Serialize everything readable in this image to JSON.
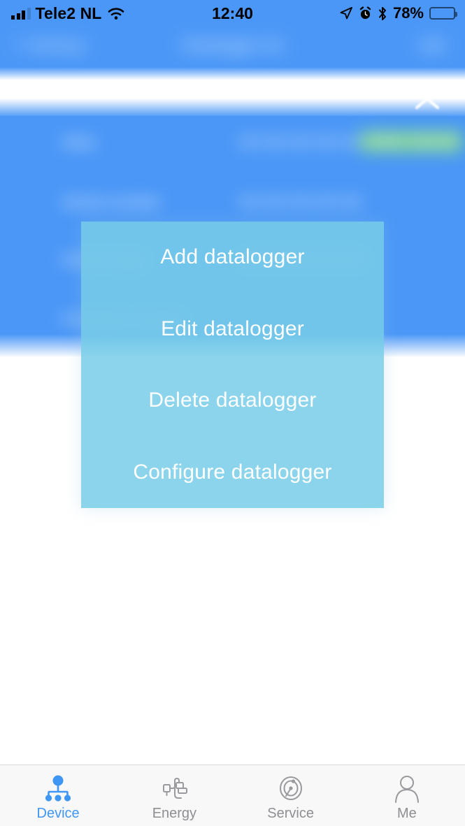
{
  "status_bar": {
    "carrier": "Tele2 NL",
    "time": "12:40",
    "battery_percent": "78%",
    "icons": {
      "signal": "signal-bars-icon",
      "wifi": "wifi-icon",
      "location": "location-arrow-icon",
      "alarm": "alarm-clock-icon",
      "bluetooth": "bluetooth-icon",
      "battery": "battery-icon"
    }
  },
  "nav_bar": {
    "back_label": "Settings",
    "title": "Datalogger list",
    "right_action": "Add",
    "blurred": true
  },
  "collapse_control": {
    "icon": "chevron-up-icon"
  },
  "detail_rows": [
    {
      "label": "Alias",
      "value": "XX:XX:XX:XX:XX",
      "badge": "Online",
      "badge2": "Normal"
    },
    {
      "label": "Serial number",
      "value": "XX:XX:XX:XX:XX",
      "badge": "",
      "badge2": ""
    },
    {
      "label": "Device type",
      "value": "XXXXXXXXXXXX",
      "badge": "",
      "badge2": ""
    },
    {
      "label": "Firmware version",
      "value": "",
      "badge": "",
      "badge2": ""
    }
  ],
  "action_sheet": {
    "items": [
      {
        "label": "Add datalogger",
        "name": "add-datalogger"
      },
      {
        "label": "Edit datalogger",
        "name": "edit-datalogger"
      },
      {
        "label": "Delete datalogger",
        "name": "delete-datalogger"
      },
      {
        "label": "Configure datalogger",
        "name": "configure-datalogger"
      }
    ],
    "background_color": "#78cde8",
    "text_color": "#ffffff"
  },
  "tab_bar": {
    "active_color": "#3f96f5",
    "inactive_color": "#8e8e93",
    "tabs": [
      {
        "label": "Device",
        "icon": "device-network-icon",
        "active": true
      },
      {
        "label": "Energy",
        "icon": "power-plug-icon",
        "active": false
      },
      {
        "label": "Service",
        "icon": "gauge-icon",
        "active": false
      },
      {
        "label": "Me",
        "icon": "person-icon",
        "active": false
      }
    ]
  }
}
